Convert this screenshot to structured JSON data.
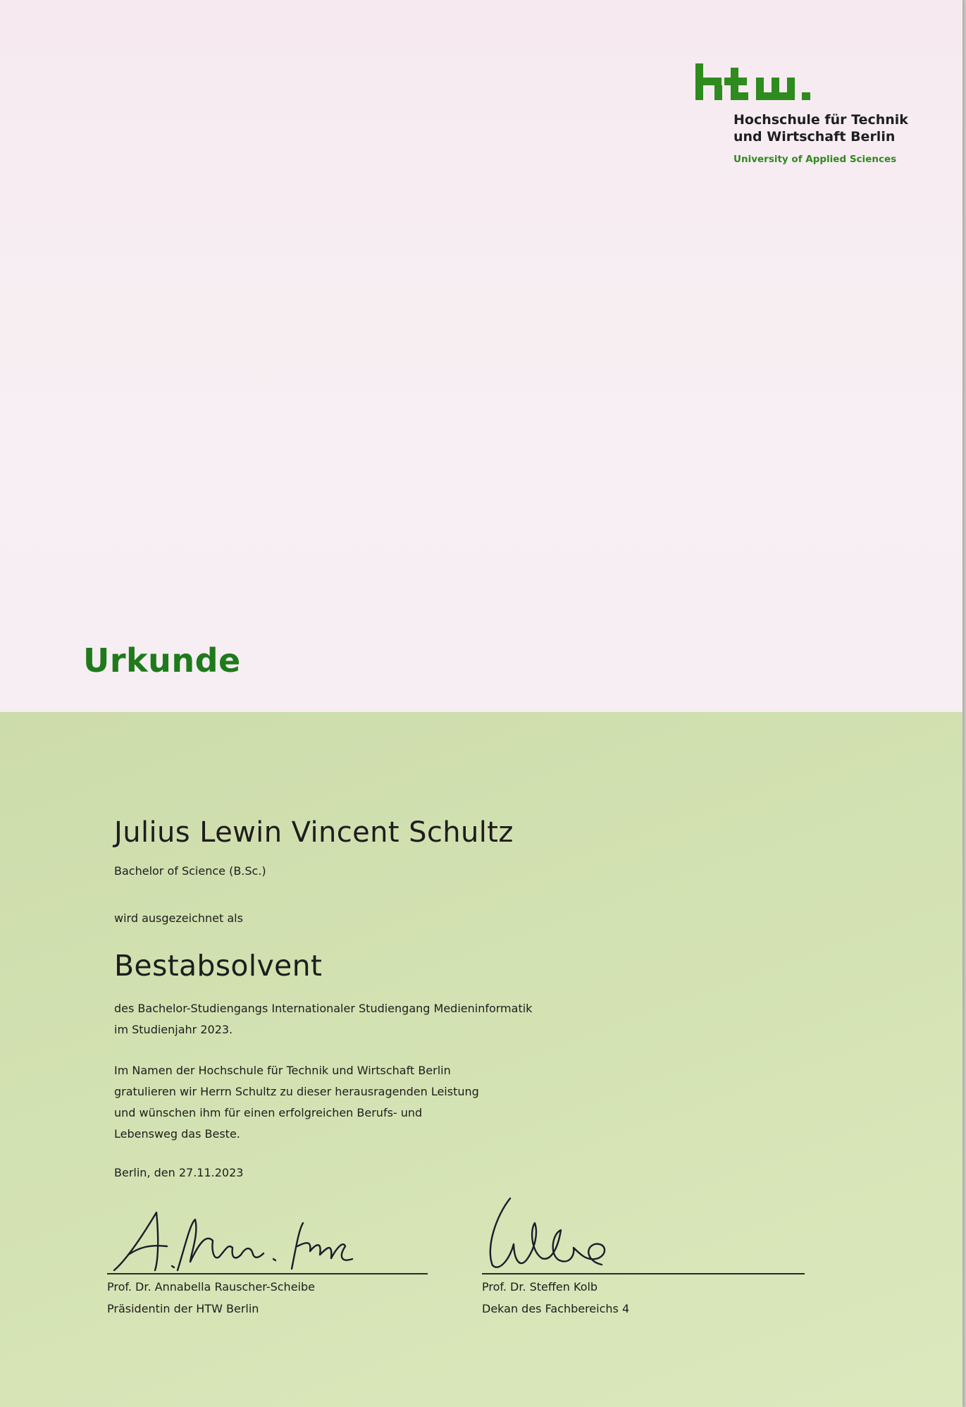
{
  "logo": {
    "mark": "htw.",
    "line1": "Hochschule für Technik",
    "line2": "und Wirtschaft Berlin",
    "subtitle": "University of Applied Sciences",
    "color": "#2f8a1d"
  },
  "title": "Urkunde",
  "recipient": {
    "name": "Julius Lewin Vincent Schultz",
    "degree": "Bachelor of Science (B.Sc.)"
  },
  "intro": "wird ausgezeichnet als",
  "award": "Bestabsolvent",
  "program": {
    "line1": "des Bachelor-Studiengangs Internationaler Studiengang Medieninformatik",
    "line2": "im Studienjahr 2023."
  },
  "congrats": {
    "line1": "Im Namen der Hochschule für Technik und Wirtschaft Berlin",
    "line2": "gratulieren wir Herrn Schultz zu dieser herausragenden Leistung",
    "line3": "und wünschen ihm für einen erfolgreichen Berufs- und",
    "line4": "Lebensweg das Beste."
  },
  "place_date": "Berlin, den 27.11.2023",
  "signatories": [
    {
      "name": "Prof. Dr. Annabella Rauscher-Scheibe",
      "role": "Präsidentin der HTW Berlin"
    },
    {
      "name": "Prof. Dr. Steffen Kolb",
      "role": "Dekan des Fachbereichs 4"
    }
  ],
  "colors": {
    "accent_green": "#1f7a1b",
    "top_background": "#f6eaf0",
    "bottom_background": "#d3e2b2"
  }
}
